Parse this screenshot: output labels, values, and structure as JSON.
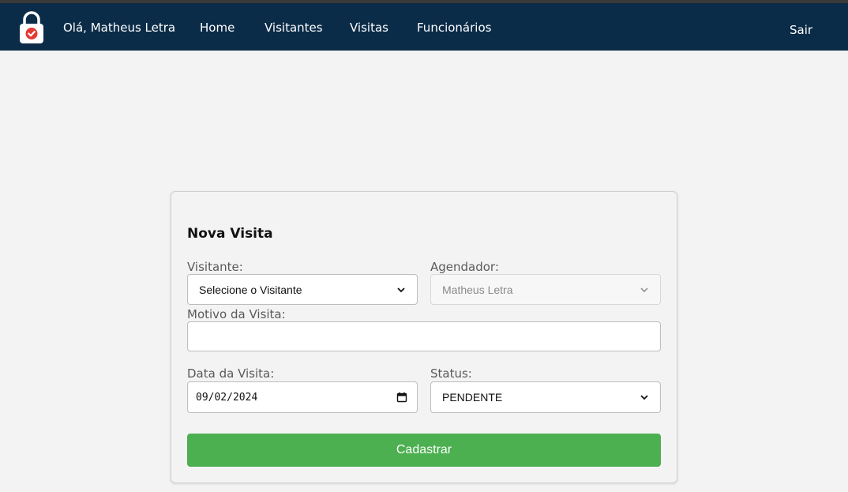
{
  "nav": {
    "greeting": "Olá, Matheus Letra",
    "links": [
      "Home",
      "Visitantes",
      "Visitas",
      "Funcionários"
    ],
    "logout": "Sair",
    "bg_color": "#0b2c48",
    "logo_icon": "lock-check-icon"
  },
  "form": {
    "title": "Nova Visita",
    "visitante_label": "Visitante:",
    "visitante_value": "Selecione o Visitante",
    "agendador_label": "Agendador:",
    "agendador_value": "Matheus Letra",
    "motivo_label": "Motivo da Visita:",
    "motivo_value": "",
    "data_label": "Data da Visita:",
    "data_value": "09/02/2024",
    "status_label": "Status:",
    "status_value": "PENDENTE",
    "submit_label": "Cadastrar",
    "submit_color": "#4caf50"
  }
}
